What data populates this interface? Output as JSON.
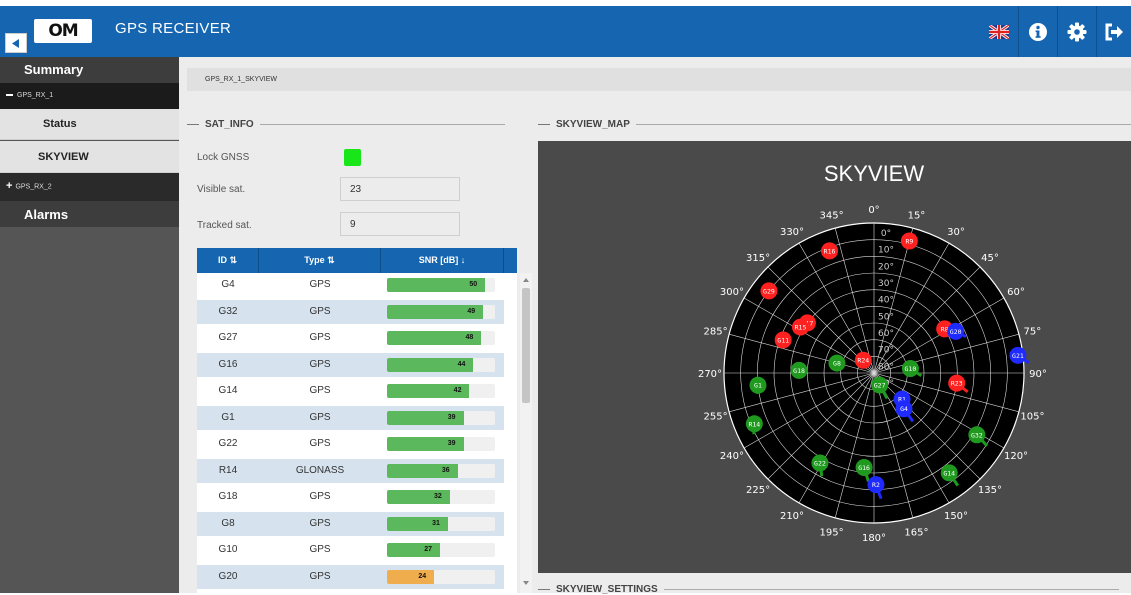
{
  "header": {
    "logo": "OM",
    "title": "GPS RECEIVER",
    "bg_color": "#1565b0",
    "icons": [
      "uk-flag-icon",
      "info-icon",
      "gear-icon",
      "logout-icon"
    ]
  },
  "sidebar": {
    "summary": "Summary",
    "rx1": "GPS_RX_1",
    "rx1_items": [
      "Status",
      "SKYVIEW"
    ],
    "rx2": "GPS_RX_2",
    "alarms": "Alarms"
  },
  "breadcrumb": "GPS_RX_1_SKYVIEW",
  "sat_info": {
    "title": "SAT_INFO",
    "lock_label": "Lock GNSS",
    "lock_color": "#19e619",
    "visible_label": "Visible sat.",
    "visible_value": "23",
    "tracked_label": "Tracked sat.",
    "tracked_value": "9"
  },
  "table": {
    "headers": [
      "ID",
      "Type",
      "SNR [dB]"
    ],
    "rows": [
      {
        "id": "G4",
        "type": "GPS",
        "snr": 50
      },
      {
        "id": "G32",
        "type": "GPS",
        "snr": 49
      },
      {
        "id": "G27",
        "type": "GPS",
        "snr": 48
      },
      {
        "id": "G16",
        "type": "GPS",
        "snr": 44
      },
      {
        "id": "G14",
        "type": "GPS",
        "snr": 42
      },
      {
        "id": "G1",
        "type": "GPS",
        "snr": 39
      },
      {
        "id": "G22",
        "type": "GPS",
        "snr": 39
      },
      {
        "id": "R14",
        "type": "GLONASS",
        "snr": 36
      },
      {
        "id": "G18",
        "type": "GPS",
        "snr": 32
      },
      {
        "id": "G8",
        "type": "GPS",
        "snr": 31
      },
      {
        "id": "G10",
        "type": "GPS",
        "snr": 27
      },
      {
        "id": "G20",
        "type": "GPS",
        "snr": 24
      }
    ],
    "bar_color": "#5cb85c",
    "low_bar_color": "#f0ad4e"
  },
  "skyview_map": {
    "section_title": "SKYVIEW_MAP",
    "title": "SKYVIEW",
    "azimuth_labels": [
      "0°",
      "15°",
      "30°",
      "45°",
      "60°",
      "75°",
      "90°",
      "105°",
      "120°",
      "135°",
      "150°",
      "165°",
      "180°",
      "195°",
      "210°",
      "225°",
      "240°",
      "255°",
      "270°",
      "285°",
      "300°",
      "315°",
      "330°",
      "345°"
    ],
    "elevation_labels": [
      "0°",
      "10°",
      "20°",
      "30°",
      "40°",
      "50°",
      "60°",
      "70°",
      "80°",
      "90°"
    ],
    "satellites": [
      {
        "id": "R9",
        "az": 15,
        "el": 8,
        "color": "#ff2020"
      },
      {
        "id": "R16",
        "az": 340,
        "el": 12,
        "color": "#ff2020"
      },
      {
        "id": "G29",
        "az": 308,
        "el": 10,
        "color": "#ff2020"
      },
      {
        "id": "R17",
        "az": 307,
        "el": 40,
        "color": "#ff2020"
      },
      {
        "id": "R15",
        "az": 302,
        "el": 38,
        "color": "#ff2020"
      },
      {
        "id": "G11",
        "az": 290,
        "el": 32,
        "color": "#ff2020"
      },
      {
        "id": "R24",
        "az": 320,
        "el": 80,
        "color": "#ff2020"
      },
      {
        "id": "R8",
        "az": 58,
        "el": 40,
        "color": "#ff2020"
      },
      {
        "id": "G20",
        "az": 63,
        "el": 35,
        "color": "#1f2aff"
      },
      {
        "id": "G21",
        "az": 83,
        "el": 3,
        "color": "#1f2aff"
      },
      {
        "id": "R23",
        "az": 97,
        "el": 40,
        "color": "#ff2020"
      },
      {
        "id": "G10",
        "az": 83,
        "el": 68,
        "color": "#1f9a1f"
      },
      {
        "id": "G8",
        "az": 285,
        "el": 67,
        "color": "#1f9a1f"
      },
      {
        "id": "G18",
        "az": 272,
        "el": 45,
        "color": "#1f9a1f"
      },
      {
        "id": "G1",
        "az": 264,
        "el": 20,
        "color": "#1f9a1f"
      },
      {
        "id": "G27",
        "az": 155,
        "el": 82,
        "color": "#1f9a1f"
      },
      {
        "id": "R1",
        "az": 133,
        "el": 67,
        "color": "#1f2aff"
      },
      {
        "id": "G4",
        "az": 140,
        "el": 62,
        "color": "#1f2aff"
      },
      {
        "id": "R14",
        "az": 247,
        "el": 12,
        "color": "#1f9a1f"
      },
      {
        "id": "G32",
        "az": 121,
        "el": 18,
        "color": "#1f9a1f"
      },
      {
        "id": "G16",
        "az": 186,
        "el": 33,
        "color": "#1f9a1f"
      },
      {
        "id": "G22",
        "az": 211,
        "el": 27,
        "color": "#1f9a1f"
      },
      {
        "id": "G14",
        "az": 143,
        "el": 15,
        "color": "#1f9a1f"
      },
      {
        "id": "R2",
        "az": 179,
        "el": 23,
        "color": "#1f2aff"
      }
    ]
  },
  "skyview_settings": {
    "title": "SKYVIEW_SETTINGS"
  }
}
